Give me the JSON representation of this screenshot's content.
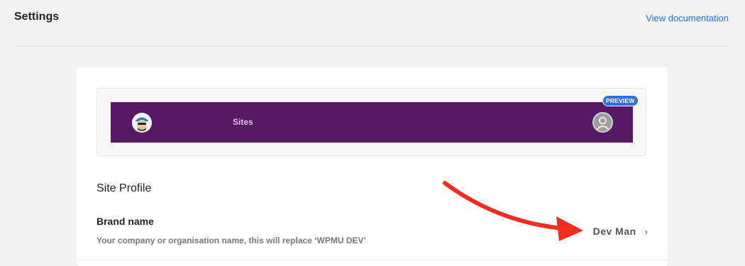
{
  "header": {
    "title": "Settings",
    "doc_link": "View documentation"
  },
  "preview": {
    "nav_label": "Sites",
    "badge": "PREVIEW",
    "bar_color": "#561865",
    "avatar_icon": "pirate-avatar-icon",
    "user_icon": "user-avatar-icon"
  },
  "profile": {
    "section_title": "Site Profile",
    "brand_label": "Brand name",
    "brand_desc": "Your company or organisation name, this will replace ‘WPMU DEV’",
    "brand_value": "Dev Man",
    "chevron": "›"
  },
  "colors": {
    "link": "#1a73e8",
    "badge": "#2f6fe0",
    "arrow": "#f12d22"
  }
}
